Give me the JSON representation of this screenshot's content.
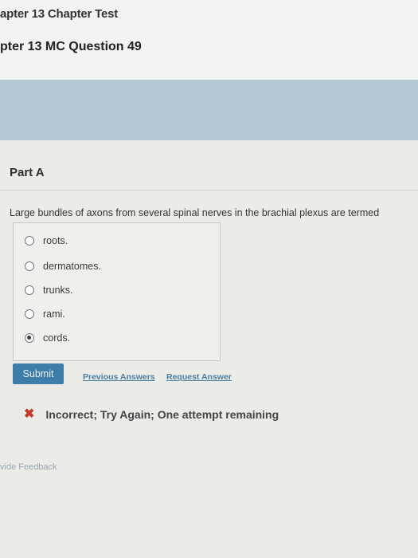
{
  "header": {
    "breadcrumb": "apter 13 Chapter Test",
    "question_title": "pter 13 MC Question 49"
  },
  "part": {
    "label": "Part A",
    "prompt": "Large bundles of axons from several spinal nerves in the brachial plexus are termed"
  },
  "options": [
    {
      "label": "roots.",
      "selected": false
    },
    {
      "label": "dermatomes.",
      "selected": false
    },
    {
      "label": "trunks.",
      "selected": false
    },
    {
      "label": "rami.",
      "selected": false
    },
    {
      "label": "cords.",
      "selected": true
    }
  ],
  "actions": {
    "submit_label": "Submit",
    "previous_answers_label": "Previous Answers",
    "request_answer_label": "Request Answer"
  },
  "feedback": {
    "message": "Incorrect; Try Again; One attempt remaining",
    "icon": "x-icon",
    "icon_color": "#c53a2d"
  },
  "footer": {
    "provide_feedback_label": "vide Feedback"
  }
}
